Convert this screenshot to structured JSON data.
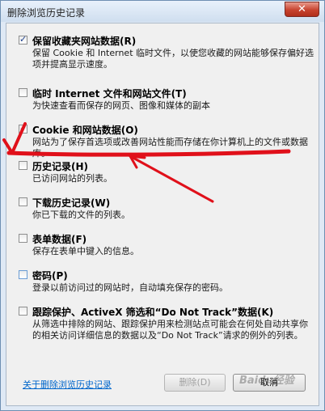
{
  "window": {
    "title": "删除浏览历史记录",
    "close_glyph": "✕"
  },
  "options": [
    {
      "title": "保留收藏夹网站数据(R)",
      "desc": "保留 Cookie 和 Internet 临时文件，以使您收藏的网站能够保存偏好选项并提高显示速度。",
      "checked": true
    },
    {
      "title": "临时 Internet 文件和网站文件(T)",
      "desc": "为快速查看而保存的网页、图像和媒体的副本",
      "checked": false
    },
    {
      "title": "Cookie 和网站数据(O)",
      "desc": "网站为了保存首选项或改善网站性能而存储在你计算机上的文件或数据库。",
      "checked": true
    },
    {
      "title": "历史记录(H)",
      "desc": "已访问网站的列表。",
      "checked": false
    },
    {
      "title": "下载历史记录(W)",
      "desc": "你已下载的文件的列表。",
      "checked": false
    },
    {
      "title": "表单数据(F)",
      "desc": "保存在表单中键入的信息。",
      "checked": false
    },
    {
      "title": "密码(P)",
      "desc": "登录以前访问过的网站时，自动填充保存的密码。",
      "checked": false
    },
    {
      "title": "跟踪保护、ActiveX 筛选和“Do Not Track”数据(K)",
      "desc": "从筛选中排除的网站、跟踪保护用来检测站点可能会在何处自动共享你的相关访问详细信息的数据以及“Do Not Track”请求的例外的列表。",
      "checked": false
    }
  ],
  "footer": {
    "link": "关于删除浏览历史记录",
    "delete_label": "删除(D)",
    "cancel_label": "取消"
  },
  "watermark": "Baidu经验",
  "colors": {
    "annotation": "#e0101a",
    "link": "#0066cc",
    "close": "#c7432f"
  }
}
